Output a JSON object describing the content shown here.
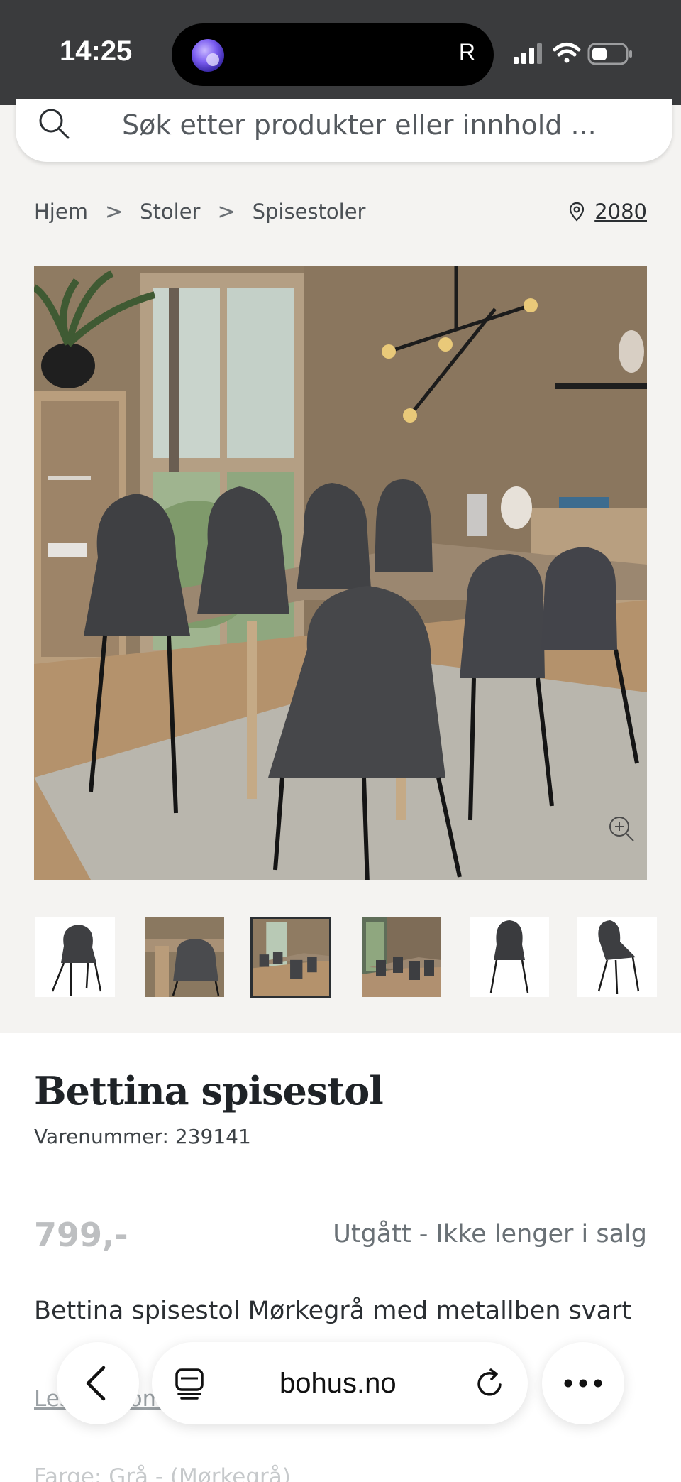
{
  "status_bar": {
    "time": "14:25",
    "island_letter": "R"
  },
  "search": {
    "placeholder": "Søk etter produkter eller innhold ..."
  },
  "breadcrumb": {
    "items": [
      "Hjem",
      "Stoler",
      "Spisestoler"
    ],
    "separator": ">"
  },
  "location": {
    "postcode": "2080"
  },
  "gallery": {
    "thumbnail_count": 6,
    "active_index": 2
  },
  "product": {
    "title": "Bettina spisestol",
    "sku_label": "Varenummer: 239141",
    "price": "799,-",
    "availability": "Utgått - Ikke lenger i salg",
    "description": "Bettina spisestol Mørkegrå med metallben svart",
    "read_more": "Les mer om produktet",
    "color_row": "Farge: Grå - (Mørkegrå)"
  },
  "browser": {
    "url": "bohus.no"
  },
  "colors": {
    "status_bar": "#3a3b3d",
    "page_background": "#f4f3f1",
    "panel_background": "#ffffff",
    "price_grey": "#bdbfc1",
    "availability_grey": "#6a7176"
  }
}
